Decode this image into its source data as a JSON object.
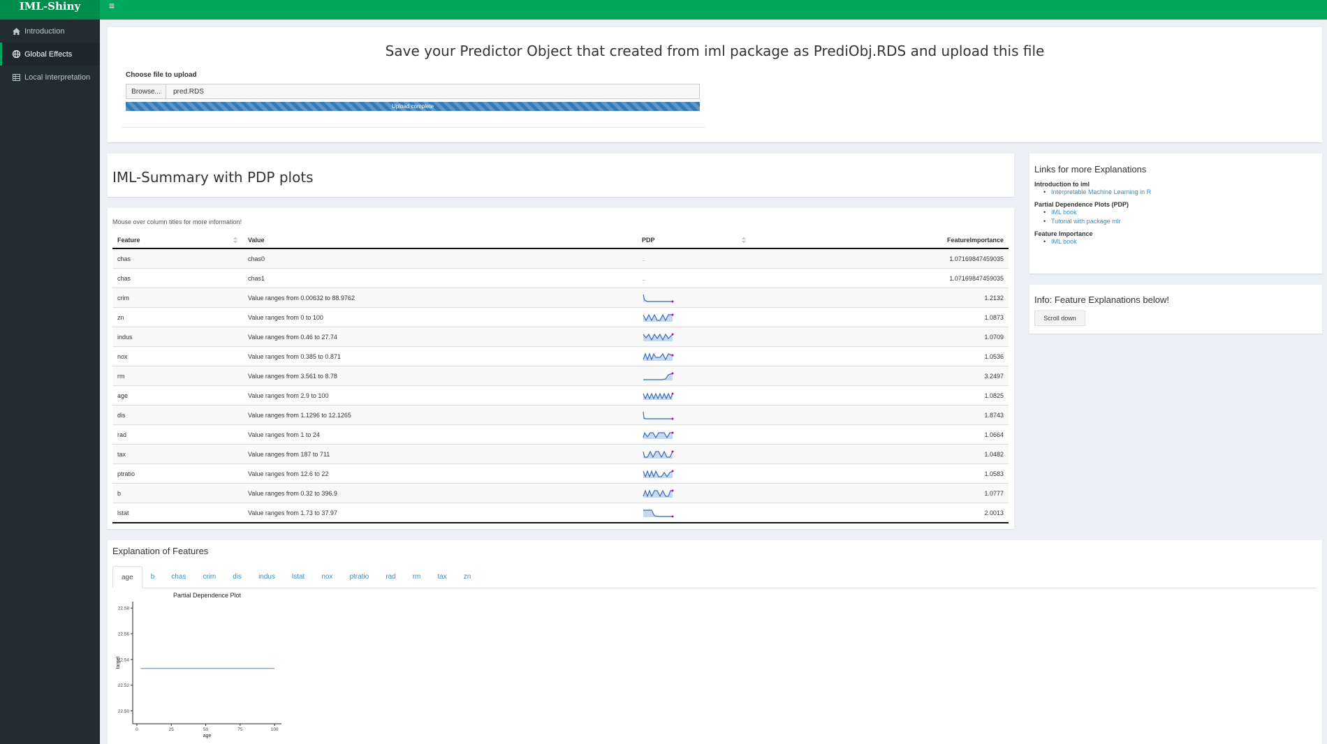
{
  "app": {
    "title": "IML-Shiny",
    "accent": "#00a65a"
  },
  "sidebar": {
    "items": [
      {
        "label": "Introduction",
        "icon": "home-icon",
        "active": false
      },
      {
        "label": "Global Effects",
        "icon": "globe-icon",
        "active": true
      },
      {
        "label": "Local Interpretation",
        "icon": "table-icon",
        "active": false
      }
    ]
  },
  "upload": {
    "heading": "Save your Predictor Object that created from iml package as PrediObj.RDS and upload this file",
    "label": "Choose file to upload",
    "browse_label": "Browse...",
    "file_name": "pred.RDS",
    "progress_text": "Upload complete",
    "progress": 1.0
  },
  "summary": {
    "title": "IML-Summary with PDP plots",
    "hint": "Mouse over column titles for more information!",
    "columns": [
      "Feature",
      "Value",
      "PDP",
      "FeatureImportance"
    ],
    "rows": [
      {
        "feature": "chas",
        "value": "chas0",
        "pdp": "..",
        "importance": "1.07169847459035"
      },
      {
        "feature": "chas",
        "value": "chas1",
        "pdp": "..",
        "importance": "1.07169847459035"
      },
      {
        "feature": "crim",
        "value": "Value ranges from 0.00632 to 88.9762",
        "pdp": "",
        "importance": "1.2132"
      },
      {
        "feature": "zn",
        "value": "Value ranges from 0 to 100",
        "pdp": "",
        "importance": "1.0873"
      },
      {
        "feature": "indus",
        "value": "Value ranges from 0.46 to 27.74",
        "pdp": "",
        "importance": "1.0709"
      },
      {
        "feature": "nox",
        "value": "Value ranges from 0.385 to 0.871",
        "pdp": "",
        "importance": "1.0536"
      },
      {
        "feature": "rm",
        "value": "Value ranges from 3.561 to 8.78",
        "pdp": "",
        "importance": "3.2497"
      },
      {
        "feature": "age",
        "value": "Value ranges from 2.9 to 100",
        "pdp": "",
        "importance": "1.0825"
      },
      {
        "feature": "dis",
        "value": "Value ranges from 1.1296 to 12.1265",
        "pdp": "",
        "importance": "1.8743"
      },
      {
        "feature": "rad",
        "value": "Value ranges from 1 to 24",
        "pdp": "",
        "importance": "1.0664"
      },
      {
        "feature": "tax",
        "value": "Value ranges from 187 to 711",
        "pdp": "",
        "importance": "1.0482"
      },
      {
        "feature": "ptratio",
        "value": "Value ranges from 12.6 to 22",
        "pdp": "",
        "importance": "1.0583"
      },
      {
        "feature": "b",
        "value": "Value ranges from 0.32 to 396.9",
        "pdp": "",
        "importance": "1.0777"
      },
      {
        "feature": "lstat",
        "value": "Value ranges from 1.73 to 37.97",
        "pdp": "",
        "importance": "2.0013"
      }
    ]
  },
  "links": {
    "title": "Links for more Explanations",
    "groups": [
      {
        "heading": "Introduction to iml",
        "items": [
          "Interpretable Machine Learning in R"
        ]
      },
      {
        "heading": "Partial Dependence Plots (PDP)",
        "items": [
          "IML book",
          "Tutorial with package mlr"
        ]
      },
      {
        "heading": "Feature Importance",
        "items": [
          "IML book"
        ]
      }
    ]
  },
  "info": {
    "title": "Info: Feature Explanations below!",
    "button": "Scroll down"
  },
  "explanation": {
    "title": "Explanation of Features",
    "tabs": [
      "age",
      "b",
      "chas",
      "crim",
      "dis",
      "indus",
      "lstat",
      "nox",
      "ptratio",
      "rad",
      "rm",
      "tax",
      "zn"
    ],
    "active_tab": "age"
  },
  "chart_data": {
    "type": "line",
    "title": "Partial Dependence Plot",
    "xlabel": "age",
    "ylabel": "target",
    "x_ticks": [
      0,
      25,
      50,
      75,
      100
    ],
    "y_ticks": [
      "22.50",
      "22.52",
      "22.54",
      "22.56",
      "22.58"
    ],
    "xlim": [
      -3,
      105
    ],
    "ylim": [
      22.49,
      22.585
    ],
    "series": [
      {
        "x": [
          2.9,
          100
        ],
        "y": [
          22.533,
          22.533
        ],
        "color": "#3c8dbc"
      }
    ]
  }
}
